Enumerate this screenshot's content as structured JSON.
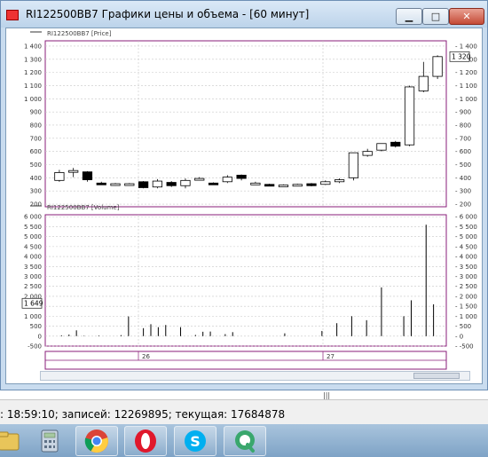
{
  "window": {
    "title": "RI122500BB7 Графики цены и объема - [60 минут]",
    "minimize_glyph": "▁",
    "maximize_glyph": "□",
    "close_glyph": "✕"
  },
  "status_bar": {
    "text": ": 18:59:10; записей: 12269895; текущая: 17684878"
  },
  "scroll_grip": "|||",
  "taskbar": {
    "items": [
      {
        "icon": "folder-icon",
        "active": false
      },
      {
        "icon": "calculator-icon",
        "active": false
      },
      {
        "icon": "chrome-icon",
        "active": true
      },
      {
        "icon": "opera-icon",
        "active": true
      },
      {
        "icon": "skype-icon",
        "active": true
      },
      {
        "icon": "qip-icon",
        "active": true
      }
    ]
  },
  "chart_data": [
    {
      "type": "candlestick",
      "legend": "RI122500BB7 [Price]",
      "y_ticks": [
        200,
        300,
        400,
        500,
        600,
        700,
        800,
        900,
        1000,
        1100,
        1200,
        1300,
        1400
      ],
      "ylim": [
        180,
        1440
      ],
      "current_label": "1 320",
      "grid": true,
      "candles": [
        {
          "o": 380,
          "h": 460,
          "l": 370,
          "c": 440
        },
        {
          "o": 445,
          "h": 475,
          "l": 405,
          "c": 455
        },
        {
          "o": 445,
          "h": 450,
          "l": 370,
          "c": 385
        },
        {
          "o": 360,
          "h": 370,
          "l": 350,
          "c": 350
        },
        {
          "o": 350,
          "h": 360,
          "l": 340,
          "c": 355
        },
        {
          "o": 350,
          "h": 360,
          "l": 345,
          "c": 355
        },
        {
          "o": 370,
          "h": 375,
          "l": 320,
          "c": 325
        },
        {
          "o": 330,
          "h": 390,
          "l": 320,
          "c": 375
        },
        {
          "o": 365,
          "h": 375,
          "l": 330,
          "c": 340
        },
        {
          "o": 340,
          "h": 395,
          "l": 320,
          "c": 380
        },
        {
          "o": 390,
          "h": 405,
          "l": 380,
          "c": 395
        },
        {
          "o": 360,
          "h": 365,
          "l": 345,
          "c": 350
        },
        {
          "o": 370,
          "h": 420,
          "l": 360,
          "c": 405
        },
        {
          "o": 420,
          "h": 425,
          "l": 380,
          "c": 395
        },
        {
          "o": 355,
          "h": 370,
          "l": 345,
          "c": 360
        },
        {
          "o": 350,
          "h": 355,
          "l": 340,
          "c": 345
        },
        {
          "o": 345,
          "h": 350,
          "l": 340,
          "c": 345
        },
        {
          "o": 345,
          "h": 355,
          "l": 340,
          "c": 350
        },
        {
          "o": 355,
          "h": 360,
          "l": 335,
          "c": 340
        },
        {
          "o": 350,
          "h": 380,
          "l": 345,
          "c": 370
        },
        {
          "o": 370,
          "h": 395,
          "l": 360,
          "c": 385
        },
        {
          "o": 400,
          "h": 590,
          "l": 380,
          "c": 590
        },
        {
          "o": 570,
          "h": 620,
          "l": 560,
          "c": 600
        },
        {
          "o": 610,
          "h": 660,
          "l": 600,
          "c": 660
        },
        {
          "o": 670,
          "h": 680,
          "l": 630,
          "c": 640
        },
        {
          "o": 650,
          "h": 1100,
          "l": 640,
          "c": 1090
        },
        {
          "o": 1060,
          "h": 1280,
          "l": 1050,
          "c": 1170
        },
        {
          "o": 1170,
          "h": 1330,
          "l": 1150,
          "c": 1320
        }
      ]
    },
    {
      "type": "bar",
      "legend": "RI122500BB7 [Volume]",
      "y_ticks": [
        -500,
        0,
        500,
        1000,
        1500,
        2000,
        2500,
        3000,
        3500,
        4000,
        4500,
        5000,
        5500,
        6000
      ],
      "ylim": [
        -500,
        6100
      ],
      "current_label": "1 649",
      "grid": true,
      "values": [
        0,
        40,
        80,
        290,
        20,
        0,
        30,
        0,
        0,
        50,
        990,
        0,
        400,
        600,
        450,
        560,
        0,
        450,
        0,
        60,
        220,
        230,
        0,
        100,
        200,
        0,
        0,
        0,
        0,
        0,
        0,
        140,
        0,
        0,
        0,
        0,
        260,
        0,
        650,
        0,
        1000,
        0,
        800,
        0,
        2450,
        0,
        0,
        1000,
        1800,
        0,
        5600,
        1600
      ]
    }
  ],
  "date_labels": [
    "26",
    "27"
  ]
}
